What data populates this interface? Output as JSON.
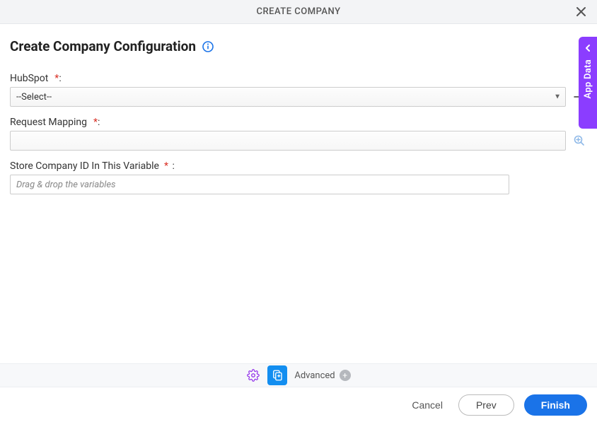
{
  "header": {
    "title": "CREATE COMPANY"
  },
  "page": {
    "title": "Create Company Configuration"
  },
  "fields": {
    "hubspot": {
      "label": "HubSpot",
      "required_marker": "*",
      "colon": ":",
      "selected": "--Select--"
    },
    "request_mapping": {
      "label": "Request Mapping",
      "required_marker": "*",
      "colon": ":",
      "value": ""
    },
    "store_company_id": {
      "label": "Store Company ID In This Variable",
      "required_marker": "*",
      "colon": ":",
      "placeholder": "Drag & drop the variables"
    }
  },
  "toolbar": {
    "advanced_label": "Advanced"
  },
  "footer": {
    "cancel": "Cancel",
    "prev": "Prev",
    "finish": "Finish"
  },
  "side_tab": {
    "label": "App Data"
  }
}
